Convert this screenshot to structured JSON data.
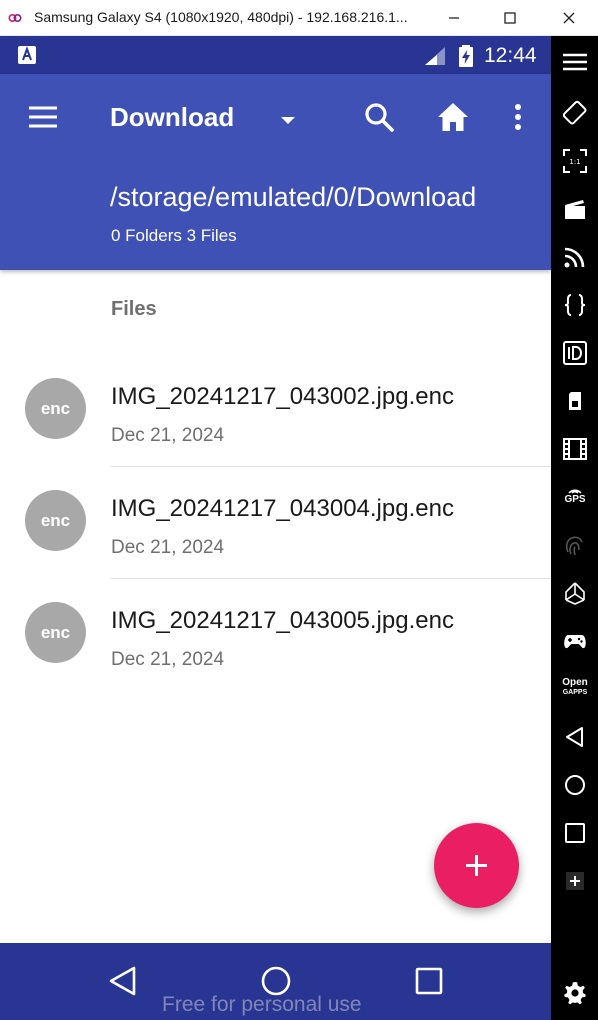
{
  "window": {
    "title": "Samsung Galaxy S4 (1080x1920, 480dpi) - 192.168.216.1..."
  },
  "statusbar": {
    "time": "12:44"
  },
  "appbar": {
    "title": "Download",
    "path": "/storage/emulated/0/Download",
    "count": "0 Folders 3 Files"
  },
  "list": {
    "section_header": "Files",
    "files": [
      {
        "avatar": "enc",
        "name": "IMG_20241217_043002.jpg.enc",
        "date": "Dec 21, 2024"
      },
      {
        "avatar": "enc",
        "name": "IMG_20241217_043004.jpg.enc",
        "date": "Dec 21, 2024"
      },
      {
        "avatar": "enc",
        "name": "IMG_20241217_043005.jpg.enc",
        "date": "Dec 21, 2024"
      }
    ]
  },
  "watermark": "Free for personal use",
  "sidebar": {
    "gps_label": "GPS",
    "opengapps_label_1": "Open",
    "opengapps_label_2": "GAPPS"
  },
  "colors": {
    "appbar": "#3f51b5",
    "statusbar": "#283593",
    "fab": "#e91e63",
    "avatar": "#a8a8a8"
  }
}
